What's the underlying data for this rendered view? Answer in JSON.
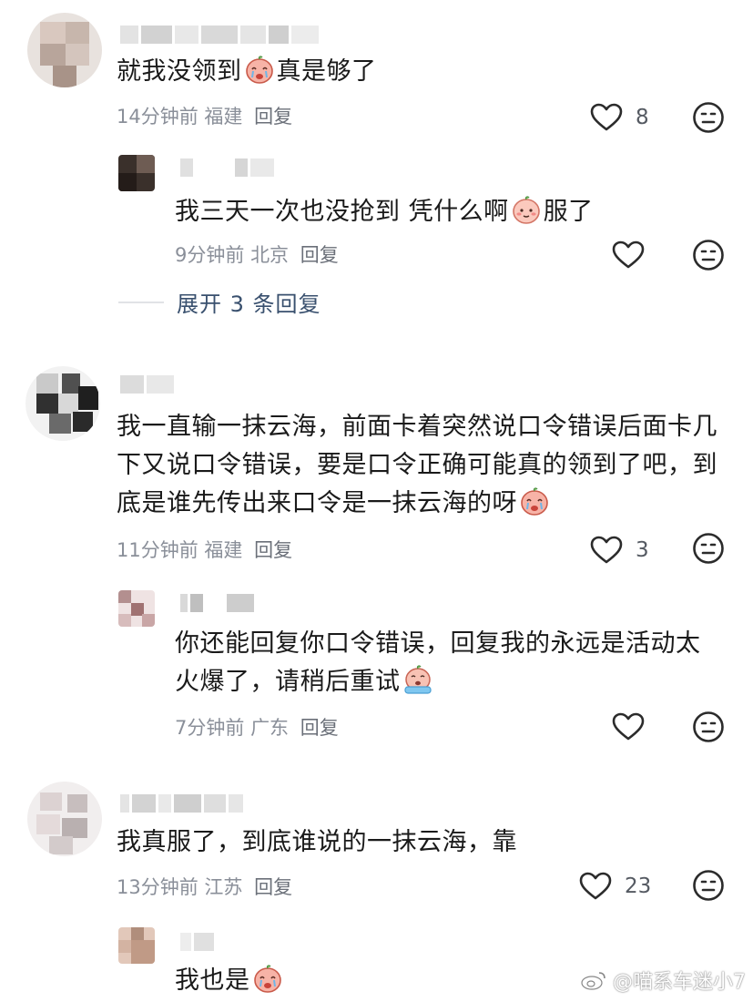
{
  "comments": [
    {
      "text": "就我没领到",
      "text_after_emoji": "真是够了",
      "time": "14分钟前",
      "location": "福建",
      "reply_label": "回复",
      "likes": "8",
      "replies": [
        {
          "text": "我三天一次也没抢到 凭什么啊",
          "text_after_emoji": "服了",
          "time": "9分钟前",
          "location": "北京",
          "reply_label": "回复"
        }
      ],
      "expand_label": "展开 3 条回复"
    },
    {
      "text": "我一直输一抹云海，前面卡着突然说口令错误后面卡几下又说口令错误，要是口令正确可能真的领到了吧，到底是谁先传出来口令是一抹云海的呀",
      "time": "11分钟前",
      "location": "福建",
      "reply_label": "回复",
      "likes": "3",
      "replies": [
        {
          "text": "你还能回复你口令错误，回复我的永远是活动太火爆了，请稍后重试",
          "time": "7分钟前",
          "location": "广东",
          "reply_label": "回复"
        }
      ]
    },
    {
      "text": "我真服了，到底谁说的一抹云海，靠",
      "time": "13分钟前",
      "location": "江苏",
      "reply_label": "回复",
      "likes": "23",
      "replies": [
        {
          "text": "我也是"
        }
      ]
    }
  ],
  "watermark": "@喵系车迷小7",
  "icons": {
    "like": "heart-outline-icon",
    "dislike": "neutral-face-icon",
    "emoji_1": "peach-crying-emoji",
    "emoji_2": "peach-blush-emoji",
    "emoji_3": "peach-crying-emoji",
    "emoji_4": "peach-sobbing-emoji",
    "emoji_5": "peach-crying-emoji"
  },
  "colors": {
    "meta_text": "#8a8f99",
    "expand_link": "#39506e",
    "body_text": "#1a1a1a"
  }
}
